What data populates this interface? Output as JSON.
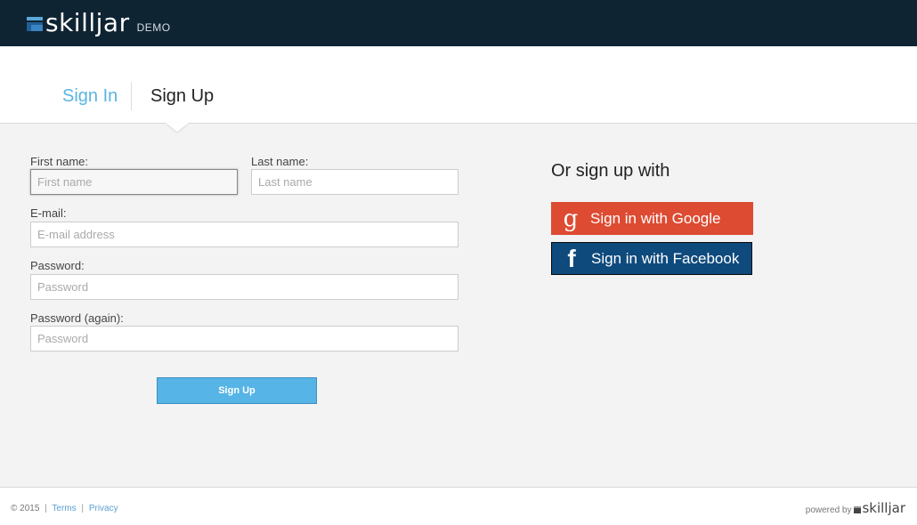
{
  "header": {
    "brand": "skilljar",
    "badge": "DEMO"
  },
  "tabs": [
    {
      "label": "Sign In",
      "active": false
    },
    {
      "label": "Sign Up",
      "active": true
    }
  ],
  "form": {
    "first_name": {
      "label": "First name:",
      "placeholder": "First name",
      "value": ""
    },
    "last_name": {
      "label": "Last name:",
      "placeholder": "Last name",
      "value": ""
    },
    "email": {
      "label": "E-mail:",
      "placeholder": "E-mail address",
      "value": ""
    },
    "password": {
      "label": "Password:",
      "placeholder": "Password",
      "value": ""
    },
    "password_again": {
      "label": "Password (again):",
      "placeholder": "Password",
      "value": ""
    },
    "submit_label": "Sign Up"
  },
  "social": {
    "title": "Or sign up with",
    "google": {
      "label": "Sign in with Google",
      "icon": "google-icon",
      "color": "#dd4b32"
    },
    "facebook": {
      "label": "Sign in with Facebook",
      "icon": "facebook-icon",
      "color": "#0f4a7d"
    }
  },
  "footer": {
    "copyright": "© 2015",
    "sep": "|",
    "terms": "Terms",
    "privacy": "Privacy",
    "powered_by": "powered by",
    "powered_brand": "skilljar"
  },
  "colors": {
    "accent": "#56b4e6",
    "topbar": "#0f2433",
    "link": "#5bb4e0"
  }
}
